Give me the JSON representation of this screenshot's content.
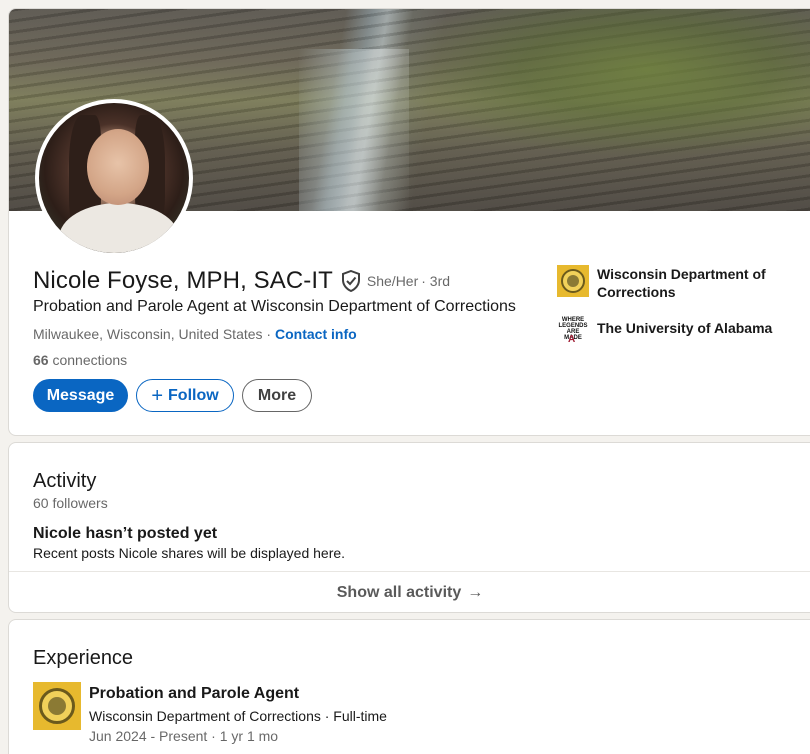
{
  "profile": {
    "name": "Nicole Foyse, MPH, SAC-IT",
    "pronouns": "She/Her",
    "degree": "· 3rd",
    "headline": "Probation and Parole Agent at Wisconsin Department of Corrections",
    "location": "Milwaukee, Wisconsin, United States",
    "location_separator": " · ",
    "contact_label": "Contact info",
    "connections_count": "66",
    "connections_label": "connections",
    "actions": {
      "message": "Message",
      "follow": "Follow",
      "more": "More"
    },
    "organizations": [
      {
        "name": "Wisconsin Department of Corrections",
        "icon": "wisconsin-seal-icon"
      },
      {
        "name": "The University of Alabama",
        "icon": "alabama-logo-icon",
        "logo_text": "WHERE LEGENDS ARE MADE",
        "logo_mark": "A"
      }
    ]
  },
  "activity": {
    "title": "Activity",
    "followers": "60 followers",
    "empty_title": "Nicole hasn’t posted yet",
    "empty_sub": "Recent posts Nicole shares will be displayed here.",
    "show_all": "Show all activity",
    "show_all_arrow": "→"
  },
  "experience": {
    "title": "Experience",
    "items": [
      {
        "title": "Probation and Parole Agent",
        "company": "Wisconsin Department of Corrections · Full-time",
        "dates": "Jun 2024 - Present · 1 yr 1 mo"
      }
    ]
  },
  "colors": {
    "accent": "#0a66c2",
    "background": "#f4f2ee"
  }
}
